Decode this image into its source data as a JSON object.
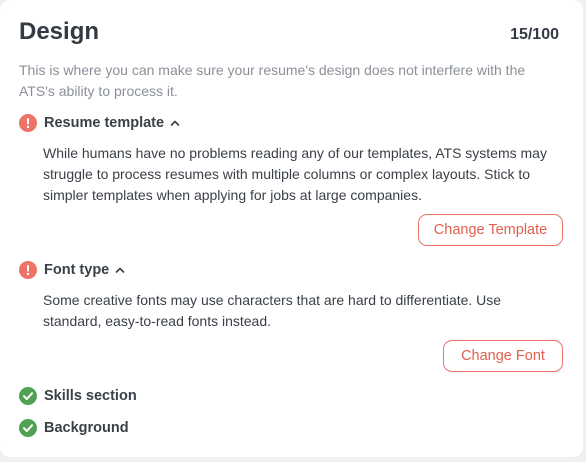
{
  "section": {
    "title": "Design",
    "score": "15/100",
    "description": "This is where you can make sure your resume's design does not interfere with the ATS's ability to process it."
  },
  "checks": [
    {
      "label": "Resume template",
      "status": "warning",
      "icon": "exclamation-circle-icon",
      "expanded": true,
      "detail": "While humans have no problems reading any of our templates, ATS systems may struggle to process resumes with multiple columns or complex layouts. Stick to simpler templates when applying for jobs at large companies.",
      "action_label": "Change Template"
    },
    {
      "label": "Font type",
      "status": "warning",
      "icon": "exclamation-circle-icon",
      "expanded": true,
      "detail": "Some creative fonts may use characters that are hard to differentiate. Use standard, easy-to-read fonts instead.",
      "action_label": "Change Font"
    },
    {
      "label": "Skills section",
      "status": "passed",
      "icon": "check-circle-icon"
    },
    {
      "label": "Background",
      "status": "passed",
      "icon": "check-circle-icon"
    }
  ],
  "colors": {
    "warning": "#ec7366",
    "passed": "#52a255",
    "accent_text": "#e0604f"
  }
}
